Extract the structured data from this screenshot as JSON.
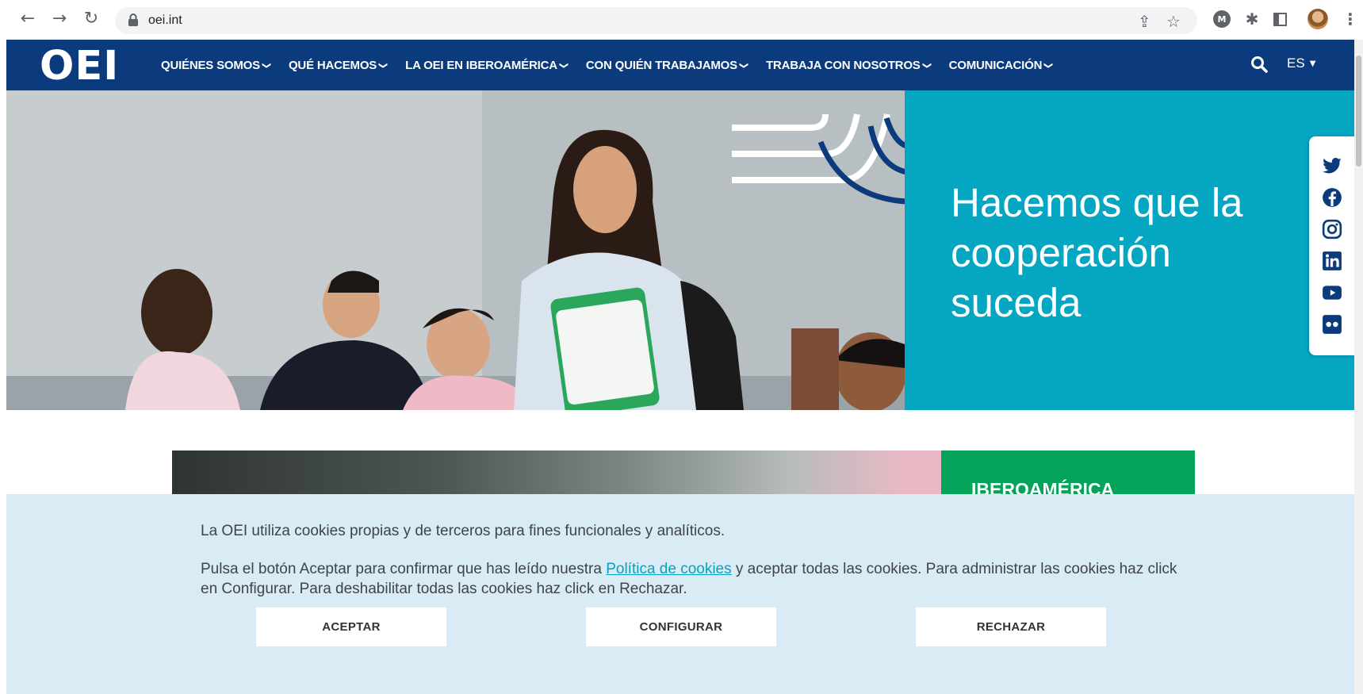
{
  "browser": {
    "url": "oei.int",
    "icons": [
      "back-icon",
      "forward-icon",
      "reload-icon",
      "lock-icon",
      "share-icon",
      "star-icon",
      "extension-m-icon",
      "puzzle-icon",
      "sidebar-icon",
      "profile-avatar",
      "kebab-menu-icon"
    ]
  },
  "nav": {
    "logo": "OEI",
    "items": [
      {
        "label": "QUIÉNES SOMOS"
      },
      {
        "label": "QUÉ HACEMOS"
      },
      {
        "label": "LA OEI EN IBEROAMÉRICA"
      },
      {
        "label": "CON QUIÉN TRABAJAMOS"
      },
      {
        "label": "TRABAJA CON NOSOTROS"
      },
      {
        "label": "COMUNICACIÓN"
      }
    ],
    "language": "ES"
  },
  "hero": {
    "title": "Hacemos que la cooperación suceda"
  },
  "social": [
    "twitter-icon",
    "facebook-icon",
    "instagram-icon",
    "linkedin-icon",
    "youtube-icon",
    "flickr-icon"
  ],
  "card": {
    "label": "IBEROAMÉRICA"
  },
  "cookies": {
    "line1": "La OEI utiliza cookies propias y de terceros para fines funcionales y analíticos.",
    "line2_before": "Pulsa el botón Aceptar para confirmar que has leído nuestra ",
    "line2_link": "Política de cookies",
    "line2_after": " y aceptar todas las cookies. Para administrar las cookies haz click en Configurar. Para deshabilitar todas las cookies haz click en Rechazar.",
    "accept": "ACEPTAR",
    "configure": "CONFIGURAR",
    "reject": "RECHAZAR"
  },
  "colors": {
    "nav_bg": "#0b3b7c",
    "hero_panel": "#04a6c2",
    "card_green": "#05a25a",
    "cookie_bg": "#d9ebf4",
    "link": "#06a3c0"
  }
}
